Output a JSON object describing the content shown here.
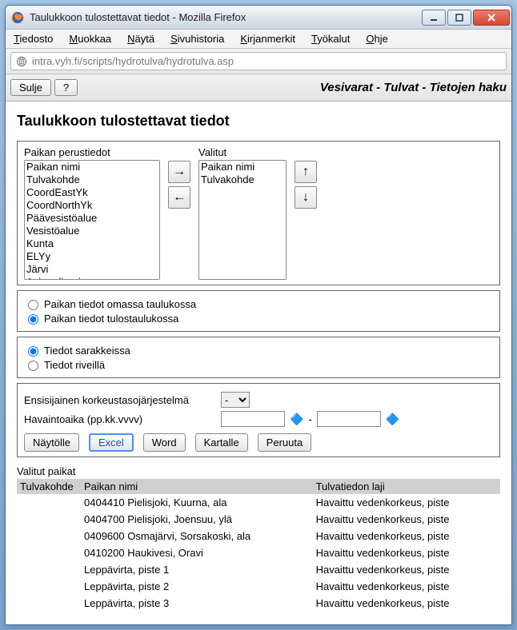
{
  "window": {
    "title": "Taulukkoon tulostettavat tiedot - Mozilla Firefox"
  },
  "menubar": [
    "Tiedosto",
    "Muokkaa",
    "Näytä",
    "Sivuhistoria",
    "Kirjanmerkit",
    "Työkalut",
    "Ohje"
  ],
  "url": "intra.vyh.fi/scripts/hydrotulva/hydrotulva.asp",
  "toolbar": {
    "close_label": "Sulje",
    "help_label": "?",
    "heading": "Vesivarat - Tulvat - Tietojen haku"
  },
  "page": {
    "title": "Taulukkoon tulostettavat tiedot",
    "available_label": "Paikan perustiedot",
    "selected_label": "Valitut",
    "available_items": [
      "Paikan nimi",
      "Tulvakohde",
      "CoordEastYk",
      "CoordNorthYk",
      "Päävesistöalue",
      "Vesistöalue",
      "Kunta",
      "ELYy",
      "Järvi",
      "Asian diaarinumero"
    ],
    "selected_items": [
      "Paikan nimi",
      "Tulvakohde"
    ],
    "radio1a": "Paikan tiedot omassa taulukossa",
    "radio1b": "Paikan tiedot tulostaulukossa",
    "radio2a": "Tiedot sarakkeissa",
    "radio2b": "Tiedot riveillä",
    "height_label": "Ensisijainen korkeustasojärjestelmä",
    "obsdate_label": "Havaintoaika (pp.kk.vvvv)",
    "date_sep": "-",
    "buttons": {
      "display": "Näytölle",
      "excel": "Excel",
      "word": "Word",
      "map": "Kartalle",
      "cancel": "Peruuta"
    },
    "selected_places_label": "Valitut paikat",
    "table": {
      "headers": [
        "Tulvakohde",
        "Paikan nimi",
        "Tulvatiedon laji"
      ],
      "rows": [
        {
          "c0": "",
          "c1": "0404410 Pielisjoki, Kuurna, ala",
          "c2": "Havaittu vedenkorkeus, piste"
        },
        {
          "c0": "",
          "c1": "0404700 Pielisjoki, Joensuu, ylä",
          "c2": "Havaittu vedenkorkeus, piste"
        },
        {
          "c0": "",
          "c1": "0409600 Osmajärvi, Sorsakoski, ala",
          "c2": "Havaittu vedenkorkeus, piste"
        },
        {
          "c0": "",
          "c1": "0410200 Haukivesi, Oravi",
          "c2": "Havaittu vedenkorkeus, piste"
        },
        {
          "c0": "",
          "c1": "Leppävirta, piste 1",
          "c2": "Havaittu vedenkorkeus, piste"
        },
        {
          "c0": "",
          "c1": "Leppävirta, piste 2",
          "c2": "Havaittu vedenkorkeus, piste"
        },
        {
          "c0": "",
          "c1": "Leppävirta, piste 3",
          "c2": "Havaittu vedenkorkeus, piste"
        }
      ]
    }
  }
}
